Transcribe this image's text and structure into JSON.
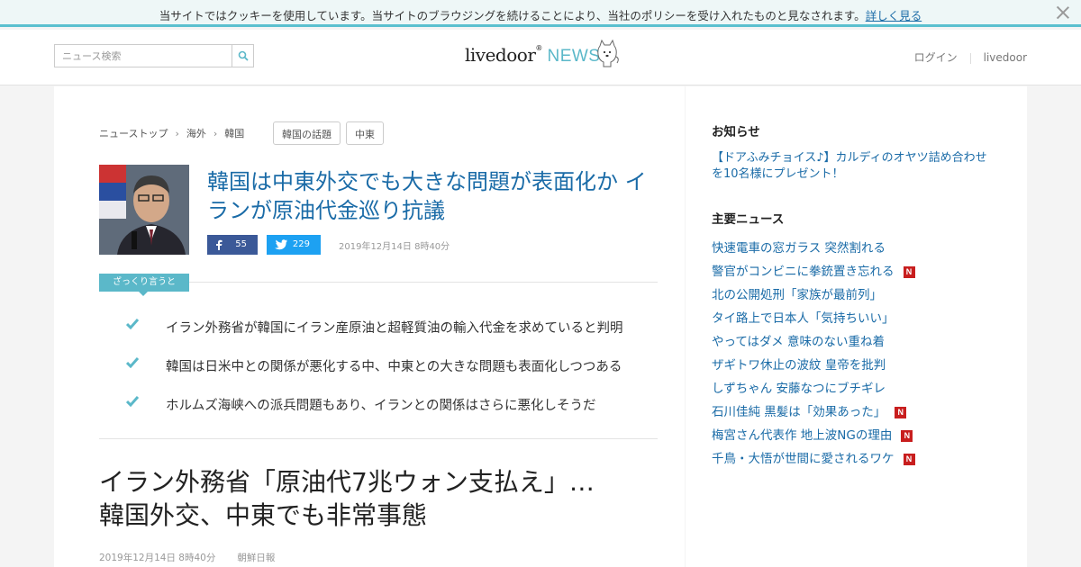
{
  "cookie_bar": {
    "text": "当サイトではクッキーを使用しています。当サイトのブラウジングを続けることにより、当社のポリシーを受け入れたものと見なされます。",
    "link": "詳しく見る"
  },
  "header": {
    "search_placeholder": "ニュース検索",
    "logo_main": "livedoor",
    "logo_mark": "®",
    "logo_news": "NEWS",
    "login": "ログイン",
    "livedoor": "livedoor"
  },
  "breadcrumb": [
    "ニューストップ",
    "海外",
    "韓国"
  ],
  "tags": [
    "韓国の話題",
    "中東"
  ],
  "article": {
    "headline": "韓国は中東外交でも大きな問題が表面化か イランが原油代金巡り抗議",
    "fb_count": "55",
    "tw_count": "229",
    "date": "2019年12月14日 8時40分",
    "summary_label": "ざっくり言うと",
    "points": [
      "イラン外務省が韓国にイラン産原油と超軽質油の輸入代金を求めていると判明",
      "韓国は日米中との関係が悪化する中、中東との大きな問題も表面化しつつある",
      "ホルムズ海峡への派兵問題もあり、イランとの関係はさらに悪化しそうだ"
    ],
    "title_line1": "イラン外務省「原油代7兆ウォン支払え」…",
    "title_line2": "韓国外交、中東でも非常事態",
    "meta_date": "2019年12月14日 8時40分",
    "source": "朝鮮日報"
  },
  "sidebar": {
    "notice_title": "お知らせ",
    "notice_text": "【ドアふみチョイス♪】カルディのオヤツ詰め合わせを10名様にプレゼント！",
    "main_news_title": "主要ニュース",
    "new_badge": "N",
    "news": [
      {
        "text": "快速電車の窓ガラス 突然割れる",
        "new": false
      },
      {
        "text": "警官がコンビニに拳銃置き忘れる",
        "new": true
      },
      {
        "text": "北の公開処刑「家族が最前列」",
        "new": false
      },
      {
        "text": "タイ路上で日本人「気持ちいい」",
        "new": false
      },
      {
        "text": "やってはダメ 意味のない重ね着",
        "new": false
      },
      {
        "text": "ザギトワ休止の波紋 皇帝を批判",
        "new": false
      },
      {
        "text": "しずちゃん 安藤なつにブチギレ",
        "new": false
      },
      {
        "text": "石川佳純 黒髪は「効果あった」",
        "new": true
      },
      {
        "text": "梅宮さん代表作 地上波NGの理由",
        "new": true
      },
      {
        "text": "千鳥・大悟が世間に愛されるワケ",
        "new": true
      }
    ]
  },
  "colors": {
    "accent": "#5bb8c9",
    "link": "#1a6ba7",
    "facebook": "#3b5998",
    "twitter": "#1da1f2",
    "new_badge": "#c81e1e"
  },
  "icons": [
    "close-icon",
    "search-icon",
    "dog-mascot-icon",
    "facebook-icon",
    "twitter-icon",
    "check-icon"
  ]
}
